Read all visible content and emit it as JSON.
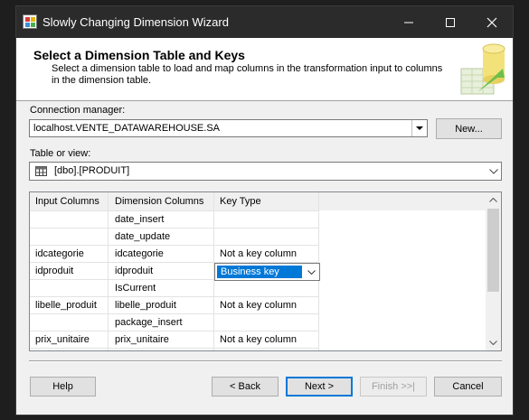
{
  "window": {
    "title": "Slowly Changing Dimension Wizard",
    "icon": "ssis-wizard-icon"
  },
  "header": {
    "title": "Select a Dimension Table and Keys",
    "description": "Select a dimension table to load and map columns in the transformation input to columns in the dimension table."
  },
  "connection": {
    "label": "Connection manager:",
    "value": "localhost.VENTE_DATAWAREHOUSE.SA",
    "new_button": "New..."
  },
  "table": {
    "label": "Table or view:",
    "value": "[dbo].[PRODUIT]",
    "icon": "table-icon"
  },
  "grid": {
    "columns": [
      "Input Columns",
      "Dimension Columns",
      "Key Type"
    ],
    "rows": [
      {
        "input": "",
        "dimension": "date_insert",
        "key": ""
      },
      {
        "input": "",
        "dimension": "date_update",
        "key": ""
      },
      {
        "input": "idcategorie",
        "dimension": "idcategorie",
        "key": "Not a key column"
      },
      {
        "input": "idproduit",
        "dimension": "idproduit",
        "key": "Business key"
      },
      {
        "input": "",
        "dimension": "IsCurrent",
        "key": ""
      },
      {
        "input": "libelle_produit",
        "dimension": "libelle_produit",
        "key": "Not a key column"
      },
      {
        "input": "",
        "dimension": "package_insert",
        "key": ""
      },
      {
        "input": "prix_unitaire",
        "dimension": "prix_unitaire",
        "key": "Not a key column"
      }
    ]
  },
  "buttons": {
    "help": "Help",
    "back": "< Back",
    "next": "Next >",
    "finish": "Finish >>|",
    "cancel": "Cancel"
  },
  "colors": {
    "titlebar": "#2b2b2b",
    "selection": "#0078d7"
  }
}
